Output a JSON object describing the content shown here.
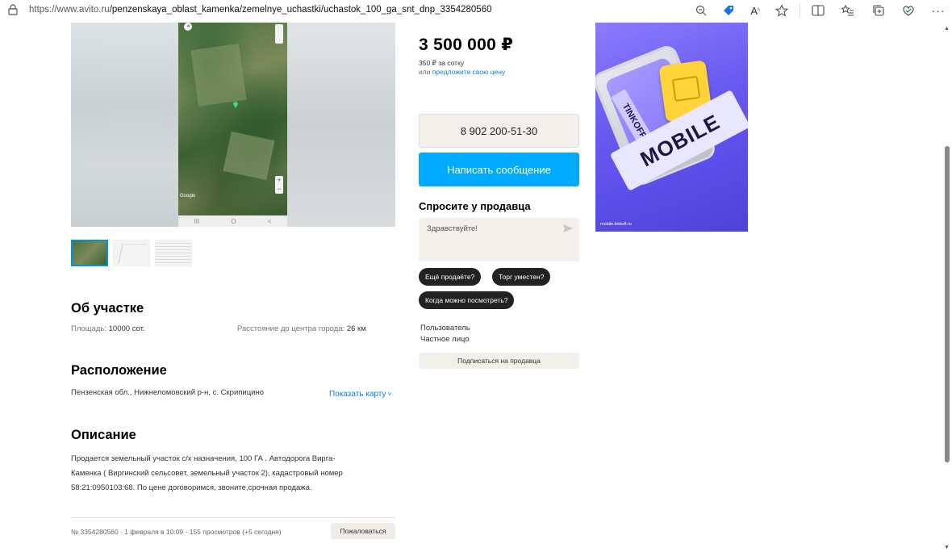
{
  "browser": {
    "url_prefix": "https://www.avito.ru",
    "url_path": "/penzenskaya_oblast_kamenka/zemelnye_uchastki/uchastok_100_ga_snt_dnp_3354280560",
    "icons": [
      "zoom-out-icon",
      "tag-icon",
      "read-aloud-icon",
      "favorite-star-icon",
      "split-screen-icon",
      "favorites-list-icon",
      "collections-icon",
      "browser-essentials-icon",
      "more-icon"
    ]
  },
  "gallery": {
    "map_labels": {
      "google": "Google",
      "zoom_in": "+",
      "zoom_out": "−",
      "nav": [
        "III",
        "O",
        "<"
      ]
    }
  },
  "price": {
    "value": "3 500 000 ₽",
    "per_unit": "350 ₽ за сотку",
    "offer_prefix": "или ",
    "offer_link": "предложите свою цену"
  },
  "contact": {
    "phone": "8 902 200-51-30",
    "write_message": "Написать сообщение"
  },
  "ask": {
    "title": "Спросите у продавца",
    "placeholder": "Здравствуйте!",
    "chips": [
      "Ещё продаёте?",
      "Торг уместен?",
      "Когда можно посмотреть?"
    ]
  },
  "seller": {
    "name": "Пользователь",
    "type": "Частное лицо",
    "subscribe": "Подписаться на продавца"
  },
  "about": {
    "title": "Об участке",
    "area_label": "Площадь: ",
    "area_value": "10000 сот.",
    "distance_label": "Расстояние до центра города: ",
    "distance_value": "26 км"
  },
  "location": {
    "title": "Расположение",
    "address": "Пензенская обл., Нижнеломовский р-н, с. Скрипицино",
    "show_map": "Показать карту"
  },
  "description": {
    "title": "Описание",
    "lines": [
      "Продается земельный участок с/х назначения, 100 ГА . Автодорога Вирга-",
      "Каменка ( Виргинский сельсовет, земельный участок 2), кадастровый номер",
      "58:21:0950103:68. По цене договоримся, звоните,срочная продажа."
    ]
  },
  "footer": {
    "meta": "№ 3354280560 · 1 февраля в 10:09 · 155 просмотров (+5 сегодня)",
    "report": "Пожаловаться"
  },
  "ad": {
    "text_big": "MOBILE",
    "text_small": "TINKOFF",
    "domain": "mobile.tinkoff.ru"
  },
  "colors": {
    "accent_blue": "#00aaff",
    "link_blue": "#0a80e0",
    "beige_button": "#f3efea",
    "chip_dark": "#222222",
    "ad_purple": "#6a5cf0",
    "sim_yellow": "#ffd43b"
  }
}
